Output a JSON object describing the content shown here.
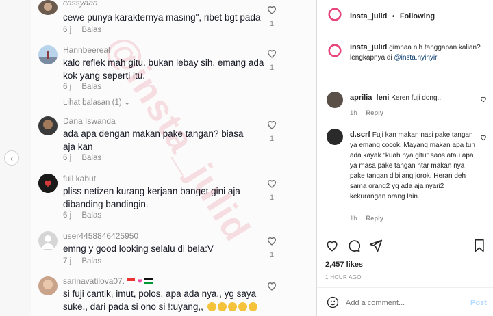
{
  "tiktok": {
    "comments": [
      {
        "user": "cassyaaa",
        "text": "cewe punya karakternya masing\", ribet bgt pada",
        "time": "6 j",
        "reply": "Balas",
        "likes": "1"
      },
      {
        "user": "Hannbeereal",
        "text": "kalo reflek mah gitu. bukan lebay sih. emang ada kok yang seperti itu.",
        "time": "6 j",
        "reply": "Balas",
        "likes": "1",
        "view_replies": "Lihat balasan (1)"
      },
      {
        "user": "Dana Iswanda",
        "text": "ada apa dengan makan pake tangan? biasa aja kan",
        "time": "6 j",
        "reply": "Balas",
        "likes": "1"
      },
      {
        "user": "full kabut",
        "text": "pliss netizen kurang kerjaan banget gini aja dibanding bandingin.",
        "time": "6 j",
        "reply": "Balas",
        "likes": "1"
      },
      {
        "user": "user4458846425950",
        "text": "emng y good looking selalu di bela:V",
        "time": "7 j",
        "reply": "Balas",
        "likes": "1"
      },
      {
        "user": "sarinavatilova07.",
        "text": "si fuji cantik, imut, polos, apa ada nya,, yg saya suke,, dari pada si ono si !:uyang,,",
        "likes": ""
      }
    ],
    "watermark": "@insta_julid"
  },
  "instagram": {
    "header": {
      "username": "insta_julid",
      "separator": "•",
      "follow": "Following"
    },
    "caption": {
      "username": "insta_julid",
      "text": "gimnaa nih tanggapan kalian? lengkapnya di",
      "mention": "@insta.nyinyir"
    },
    "comments": [
      {
        "username": "aprilia_leni",
        "text": "Keren fuji dong...",
        "time": "1h",
        "reply": "Reply"
      },
      {
        "username": "d.scrf",
        "text": "Fuji kan makan nasi pake tangan ya emang cocok. Mayang makan apa tuh ada kayak \"kuah nya gitu\" saos atau apa ya masa pake tangan ntar makan nya pake tangan dibilang jorok. Heran deh sama orang2 yg ada aja nyari2 kekurangan orang lain.",
        "time": "1h",
        "reply": "Reply"
      }
    ],
    "likes": "2,457 likes",
    "posted": "1 HOUR AGO",
    "add_comment": {
      "placeholder": "Add a comment...",
      "post": "Post"
    }
  },
  "colors": {
    "tiktok_text": "#161823",
    "ig_link": "#00376b",
    "post_button": "#b3dbff",
    "watermark": "#e65a6e"
  }
}
